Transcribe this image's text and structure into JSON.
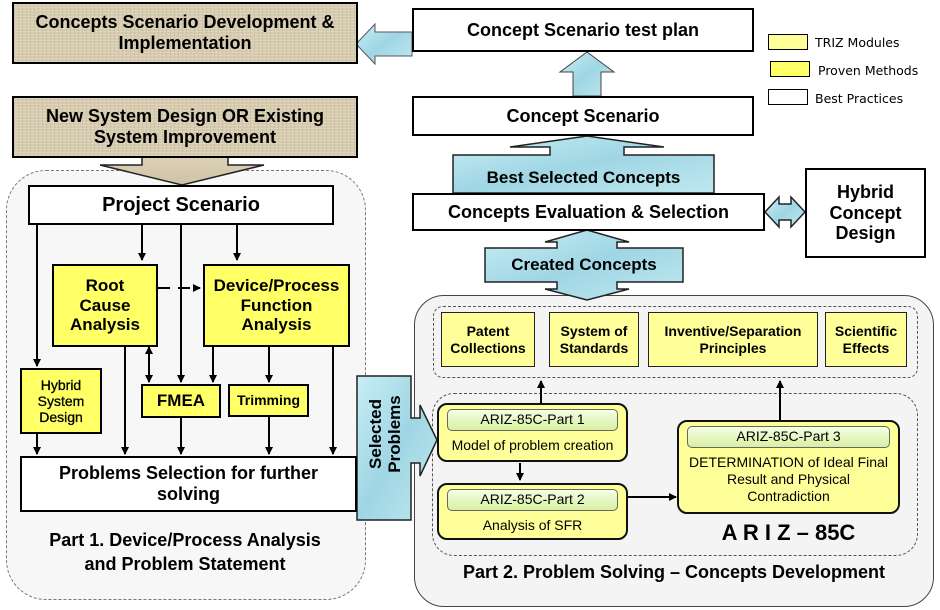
{
  "legend": [
    {
      "label": "TRIZ Modules",
      "color": "#ffff99"
    },
    {
      "label": "Proven Methods",
      "color": "#ffff66"
    },
    {
      "label": "Best Practices",
      "color": "#ffffff"
    }
  ],
  "top": {
    "implementation": "Concepts Scenario Development & Implementation",
    "start": "New System Design OR Existing System Improvement",
    "test_plan": "Concept Scenario test plan",
    "concept_scenario": "Concept Scenario",
    "best_selected": "Best Selected Concepts",
    "evaluation": "Concepts Evaluation & Selection",
    "hybrid_concept": "Hybrid Concept Design",
    "created_concepts": "Created Concepts"
  },
  "part1": {
    "project_scenario": "Project Scenario",
    "root_cause": "Root Cause Analysis",
    "function_analysis": "Device/Process Function Analysis",
    "hybrid_system": "Hybrid System Design",
    "fmea": "FMEA",
    "trimming": "Trimming",
    "problems_selection": "Problems Selection for further solving",
    "title_line1": "Part 1. Device/Process Analysis",
    "title_line2": "and Problem Statement"
  },
  "selected_problems": {
    "line1": "Selected",
    "line2": "Problems"
  },
  "part2": {
    "triz_modules": [
      "Patent Collections",
      "System of Standards",
      "Inventive/Separation Principles",
      "Scientific Effects"
    ],
    "ariz1": {
      "header": "ARIZ-85C-Part 1",
      "body": "Model of problem creation"
    },
    "ariz2": {
      "header": "ARIZ-85C-Part 2",
      "body": "Analysis of SFR"
    },
    "ariz3": {
      "header": "ARIZ-85C-Part 3",
      "body": "DETERMINATION of Ideal Final Result and Physical Contradiction"
    },
    "ariz_label": "A R I Z – 85C",
    "title": "Part 2. Problem Solving – Concepts Development"
  },
  "colors": {
    "arrow_fill": "#a8dce8",
    "proven": "#ffff66",
    "triz": "#ffff99",
    "tan": "#d8ccb0"
  }
}
